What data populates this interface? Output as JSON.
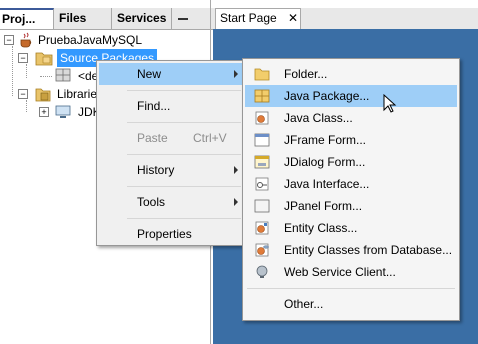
{
  "projects_panel": {
    "tabs": [
      "Proj...",
      "Files",
      "Services"
    ],
    "tree": {
      "project": "PruebaJavaMySQL",
      "source_packages": "Source Packages",
      "default_package": "<de",
      "libraries": "Libraries",
      "jdk": "JDK"
    }
  },
  "editor": {
    "tab": "Start Page",
    "close_glyph": "✕"
  },
  "context_menu": {
    "items": [
      {
        "label": "New",
        "submenu": true
      },
      {
        "label": "Find...",
        "shortcut": ""
      },
      {
        "label": "Paste",
        "shortcut": "Ctrl+V",
        "disabled": true
      },
      {
        "label": "History",
        "submenu": true
      },
      {
        "label": "Tools",
        "submenu": true
      },
      {
        "label": "Properties"
      }
    ]
  },
  "new_submenu": {
    "items": [
      {
        "label": "Folder...",
        "icon": "folder-icon"
      },
      {
        "label": "Java Package...",
        "icon": "java-package-icon",
        "highlighted": true
      },
      {
        "label": "Java Class...",
        "icon": "java-class-icon"
      },
      {
        "label": "JFrame Form...",
        "icon": "jframe-form-icon"
      },
      {
        "label": "JDialog Form...",
        "icon": "jdialog-form-icon"
      },
      {
        "label": "Java Interface...",
        "icon": "java-interface-icon"
      },
      {
        "label": "JPanel Form...",
        "icon": "jpanel-form-icon"
      },
      {
        "label": "Entity Class...",
        "icon": "entity-class-icon"
      },
      {
        "label": "Entity Classes from Database...",
        "icon": "entity-classes-db-icon"
      },
      {
        "label": "Web Service Client...",
        "icon": "web-service-client-icon"
      },
      {
        "label": "Other..."
      }
    ]
  },
  "colors": {
    "highlight": "#9ecef7",
    "selection": "#3399ff",
    "start_page_bg": "#3a6ea5"
  }
}
